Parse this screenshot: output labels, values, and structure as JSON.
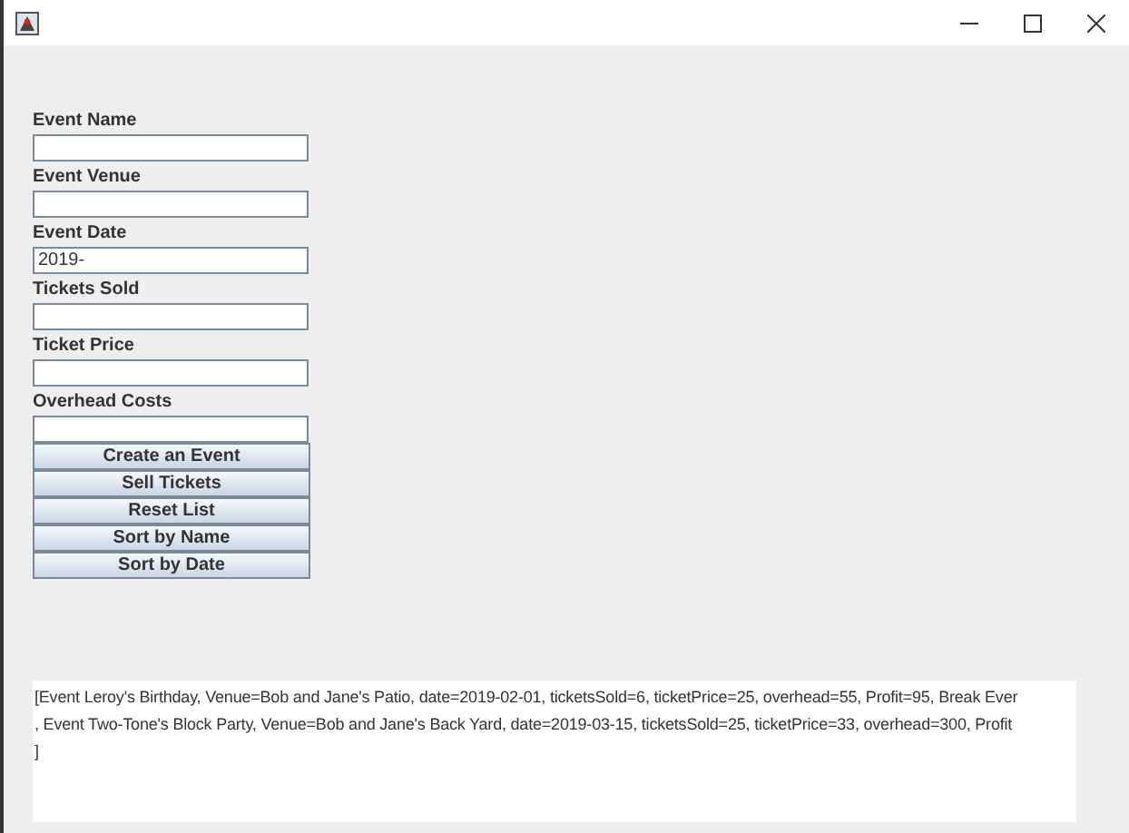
{
  "fields": [
    {
      "label": "Event Name"
    },
    {
      "label": "Event Venue"
    },
    {
      "label": "Event Date",
      "value": "2019-"
    },
    {
      "label": "Tickets Sold"
    },
    {
      "label": "Ticket Price"
    },
    {
      "label": "Overhead Costs"
    }
  ],
  "buttons": [
    "Create an Event",
    "Sell Tickets",
    "Reset List",
    "Sort by Name",
    "Sort by Date"
  ],
  "output_lines": [
    "[Event Leroy's Birthday, Venue=Bob and Jane's Patio, date=2019-02-01, ticketsSold=6, ticketPrice=25, overhead=55, Profit=95, Break Ever",
    ", Event Two-Tone's Block Party, Venue=Bob and Jane's Back Yard, date=2019-03-15, ticketsSold=25, ticketPrice=33, overhead=300, Profit",
    "]"
  ]
}
